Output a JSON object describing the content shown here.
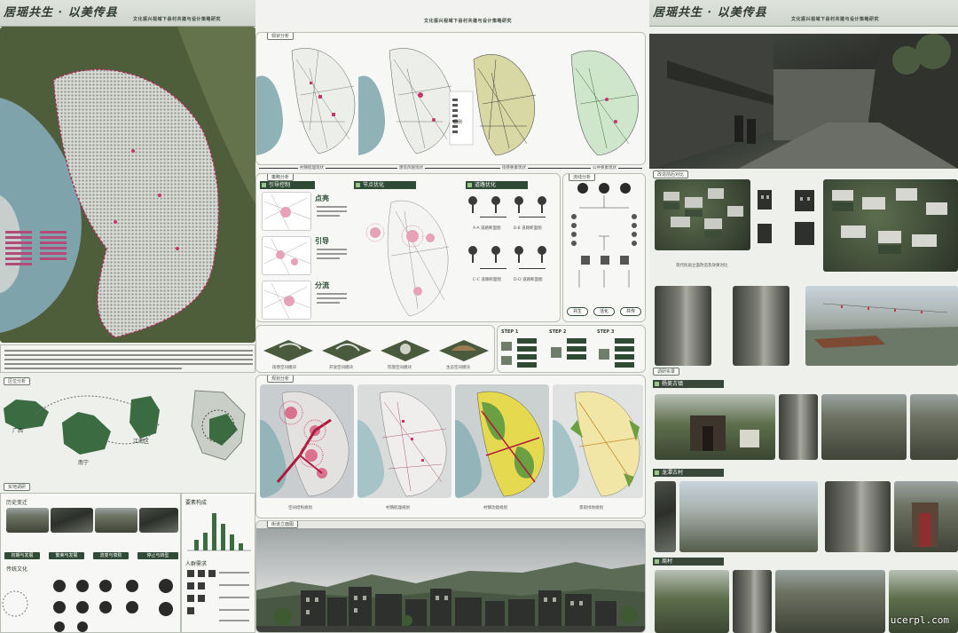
{
  "title": "居瑶共生 · 以美传县",
  "subtitle": "文化振兴视域下县村共建与设计策略研究",
  "board1": {
    "site_intro_text": "区位分析",
    "location_heading": "区位分析",
    "province": "广西",
    "city": "南宁",
    "district": "江南区",
    "survey_heading": "实地调研",
    "history_heading": "历史变迁",
    "history_stages": [
      "初期与发展",
      "繁荣与发展",
      "流变与衰败",
      "停止与转型"
    ],
    "culture_heading": "传统文化",
    "elements_heading": "要素构成",
    "needs_heading": "人群需求"
  },
  "board2": {
    "current_heading": "现状分析",
    "map_captions": [
      "村镇肌理现状",
      "建筑风貌现状",
      "街巷要素现状",
      "公共要素现状"
    ],
    "legend_title": "图例",
    "strategy_heading": "策略分析",
    "guide_heading": "引导控制",
    "node_heading": "节点优化",
    "road_heading": "道路优化",
    "points": [
      "点亮",
      "引导",
      "分流"
    ],
    "road_captions": [
      "A-A 道路断面图",
      "B-B 道路断面图",
      "C-C 道路断面图",
      "D-D 道路断面图"
    ],
    "flow_heading": "流线分析",
    "flow_nodes": [
      "共生",
      "活化",
      "共传"
    ],
    "module_captions": [
      "街巷空间模块",
      "开放空间模块",
      "院落空间模块",
      "生态空间模块"
    ],
    "steps": [
      "STEP 1",
      "STEP 2",
      "STEP 3"
    ],
    "planning_heading": "规划分析",
    "planning_captions": [
      "空间结构规划",
      "村镇肌理规划",
      "村镇功能规划",
      "景观绿地规划"
    ],
    "elevation_heading": "街道立面图"
  },
  "board3": {
    "renovation_heading": "改造前后对比",
    "renovation_caption": "现代民居立面改造及效果对比",
    "survey_heading": "调研实录",
    "villages": [
      "杨美古镇",
      "龙潭古村",
      "周村"
    ]
  },
  "watermark": "ucerpl.com"
}
